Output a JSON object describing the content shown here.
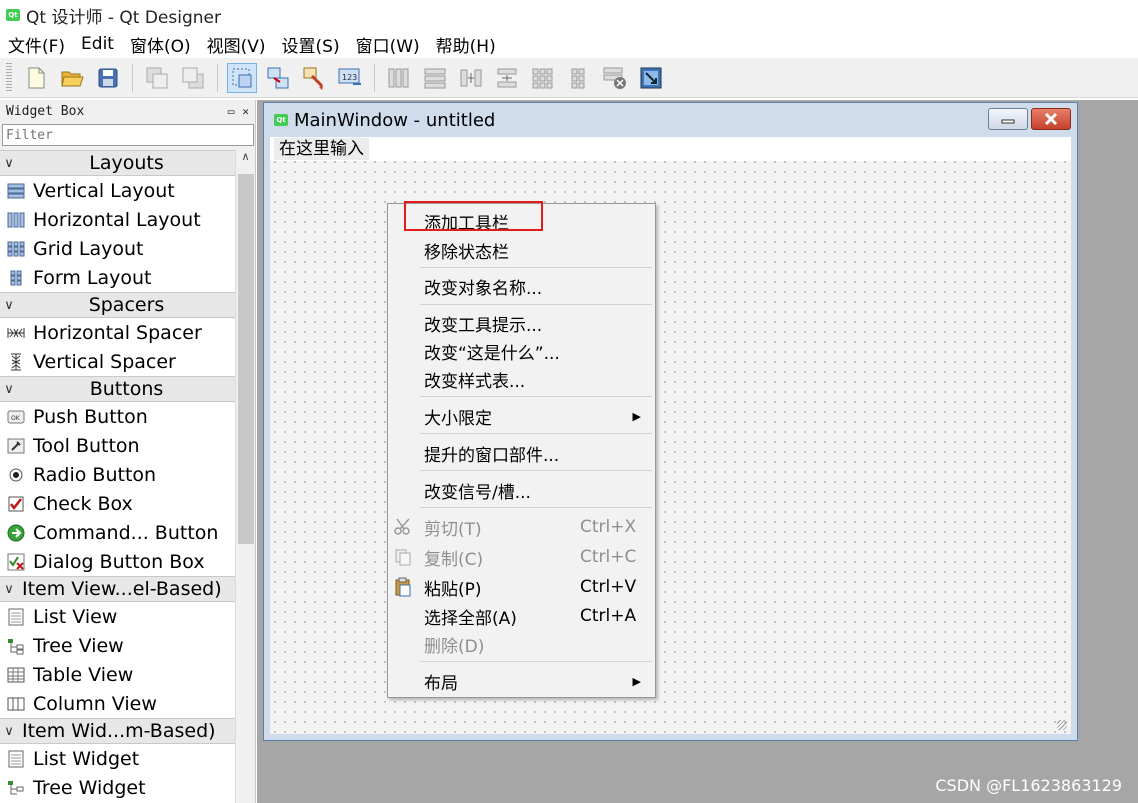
{
  "app": {
    "title": "Qt 设计师 - Qt Designer",
    "logo_text": "Qt"
  },
  "menubar": {
    "items": [
      "文件(F)",
      "Edit",
      "窗体(O)",
      "视图(V)",
      "设置(S)",
      "窗口(W)",
      "帮助(H)"
    ]
  },
  "toolbar": {
    "icons": [
      "new-file-icon",
      "open-file-icon",
      "save-icon",
      "send-to-back-icon",
      "bring-to-front-icon",
      "edit-widgets-icon",
      "edit-signals-slots-icon",
      "edit-buddies-icon",
      "edit-tab-order-icon",
      "layout-horizontal-icon",
      "layout-vertical-icon",
      "layout-horizontal-splitter-icon",
      "layout-vertical-splitter-icon",
      "layout-grid-icon",
      "layout-form-icon",
      "break-layout-icon",
      "adjust-size-icon"
    ]
  },
  "widget_box": {
    "title": "Widget Box",
    "filter_placeholder": "Filter",
    "sections": [
      {
        "name": "Layouts",
        "items": [
          "Vertical Layout",
          "Horizontal Layout",
          "Grid Layout",
          "Form Layout"
        ]
      },
      {
        "name": "Spacers",
        "items": [
          "Horizontal Spacer",
          "Vertical Spacer"
        ]
      },
      {
        "name": "Buttons",
        "items": [
          "Push Button",
          "Tool Button",
          "Radio Button",
          "Check Box",
          "Command... Button",
          "Dialog Button Box"
        ]
      },
      {
        "name": "Item View...el-Based)",
        "items": [
          "List View",
          "Tree View",
          "Table View",
          "Column View"
        ]
      },
      {
        "name": "Item Wid...m-Based)",
        "items": [
          "List Widget",
          "Tree Widget"
        ]
      }
    ]
  },
  "subwindow": {
    "title": "MainWindow - untitled",
    "type_here": "在这里输入"
  },
  "context_menu": {
    "items": [
      {
        "label": "添加工具栏",
        "highlighted": true
      },
      {
        "label": "移除状态栏"
      },
      {
        "label": "改变对象名称..."
      },
      {
        "label": "改变工具提示..."
      },
      {
        "label": "改变“这是什么”..."
      },
      {
        "label": "改变样式表..."
      },
      {
        "label": "大小限定",
        "submenu": true
      },
      {
        "label": "提升的窗口部件..."
      },
      {
        "label": "改变信号/槽..."
      },
      {
        "label": "剪切(T)",
        "shortcut": "Ctrl+X",
        "disabled": true,
        "icon": "scissors-icon"
      },
      {
        "label": "复制(C)",
        "shortcut": "Ctrl+C",
        "disabled": true,
        "icon": "copy-icon"
      },
      {
        "label": "粘贴(P)",
        "shortcut": "Ctrl+V",
        "icon": "paste-icon"
      },
      {
        "label": "选择全部(A)",
        "shortcut": "Ctrl+A"
      },
      {
        "label": "删除(D)",
        "disabled": true
      },
      {
        "label": "布局",
        "submenu": true
      }
    ]
  },
  "watermark": "CSDN @FL1623863129",
  "colors": {
    "highlight_box": "#e21b1b",
    "mdi_background": "#a6a6a6",
    "qt_green": "#41cd52"
  }
}
